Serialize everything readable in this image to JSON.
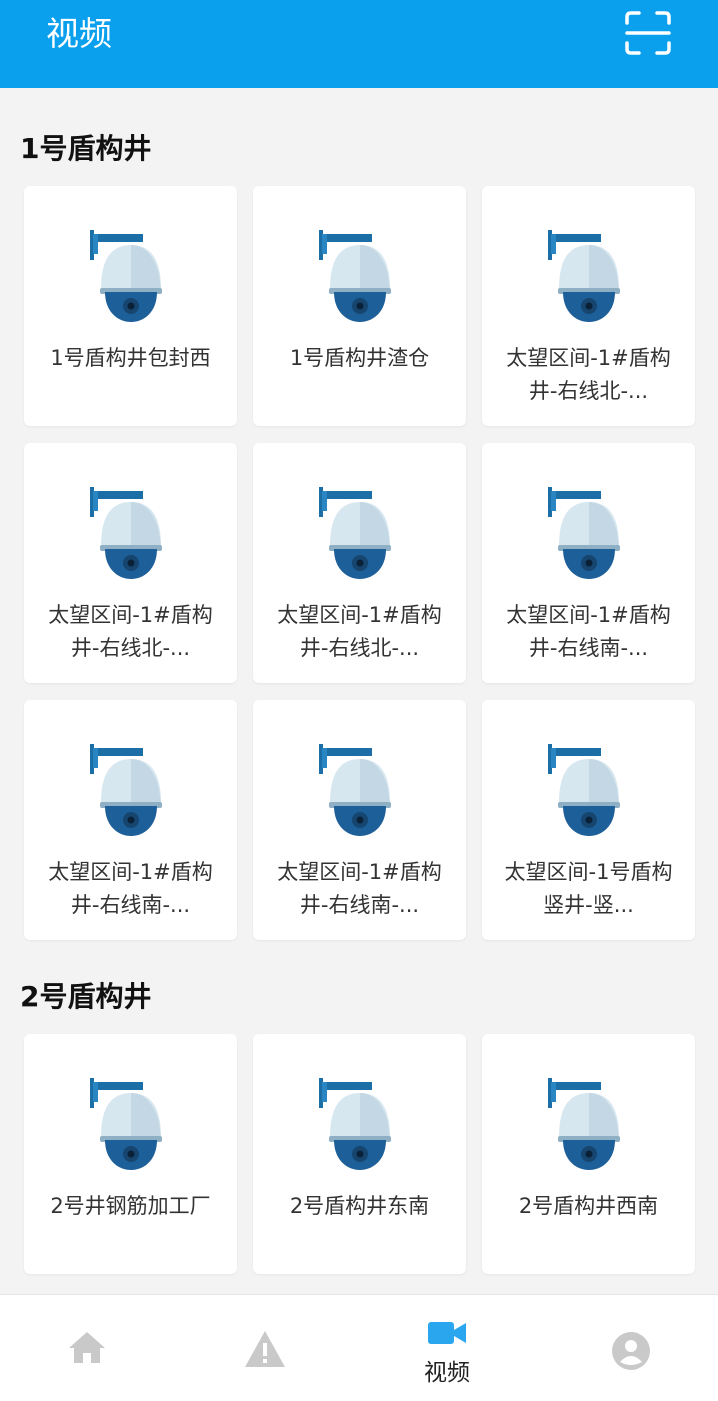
{
  "header": {
    "title": "视频",
    "scan_icon": "scan-icon",
    "bg_color": "#0aa0ee"
  },
  "sections": [
    {
      "title": "1号盾构井",
      "cameras": [
        "1号盾构井包封西",
        "1号盾构井渣仓",
        "太望区间-1#盾构井-右线北-...",
        "太望区间-1#盾构井-右线北-...",
        "太望区间-1#盾构井-右线北-...",
        "太望区间-1#盾构井-右线南-...",
        "太望区间-1#盾构井-右线南-...",
        "太望区间-1#盾构井-右线南-...",
        "太望区间-1号盾构竖井-竖..."
      ]
    },
    {
      "title": "2号盾构井",
      "cameras": [
        "2号井钢筋加工厂",
        "2号盾构井东南",
        "2号盾构井西南"
      ]
    }
  ],
  "camera_icon": "security-camera-icon",
  "tabbar": {
    "tabs": [
      {
        "icon": "home-icon",
        "label": ""
      },
      {
        "icon": "warning-icon",
        "label": ""
      },
      {
        "icon": "video-camera-icon",
        "label": "视频",
        "active": true
      },
      {
        "icon": "user-icon",
        "label": ""
      }
    ],
    "active_color": "#2aa6ee",
    "inactive_color": "#c9c9c9"
  }
}
